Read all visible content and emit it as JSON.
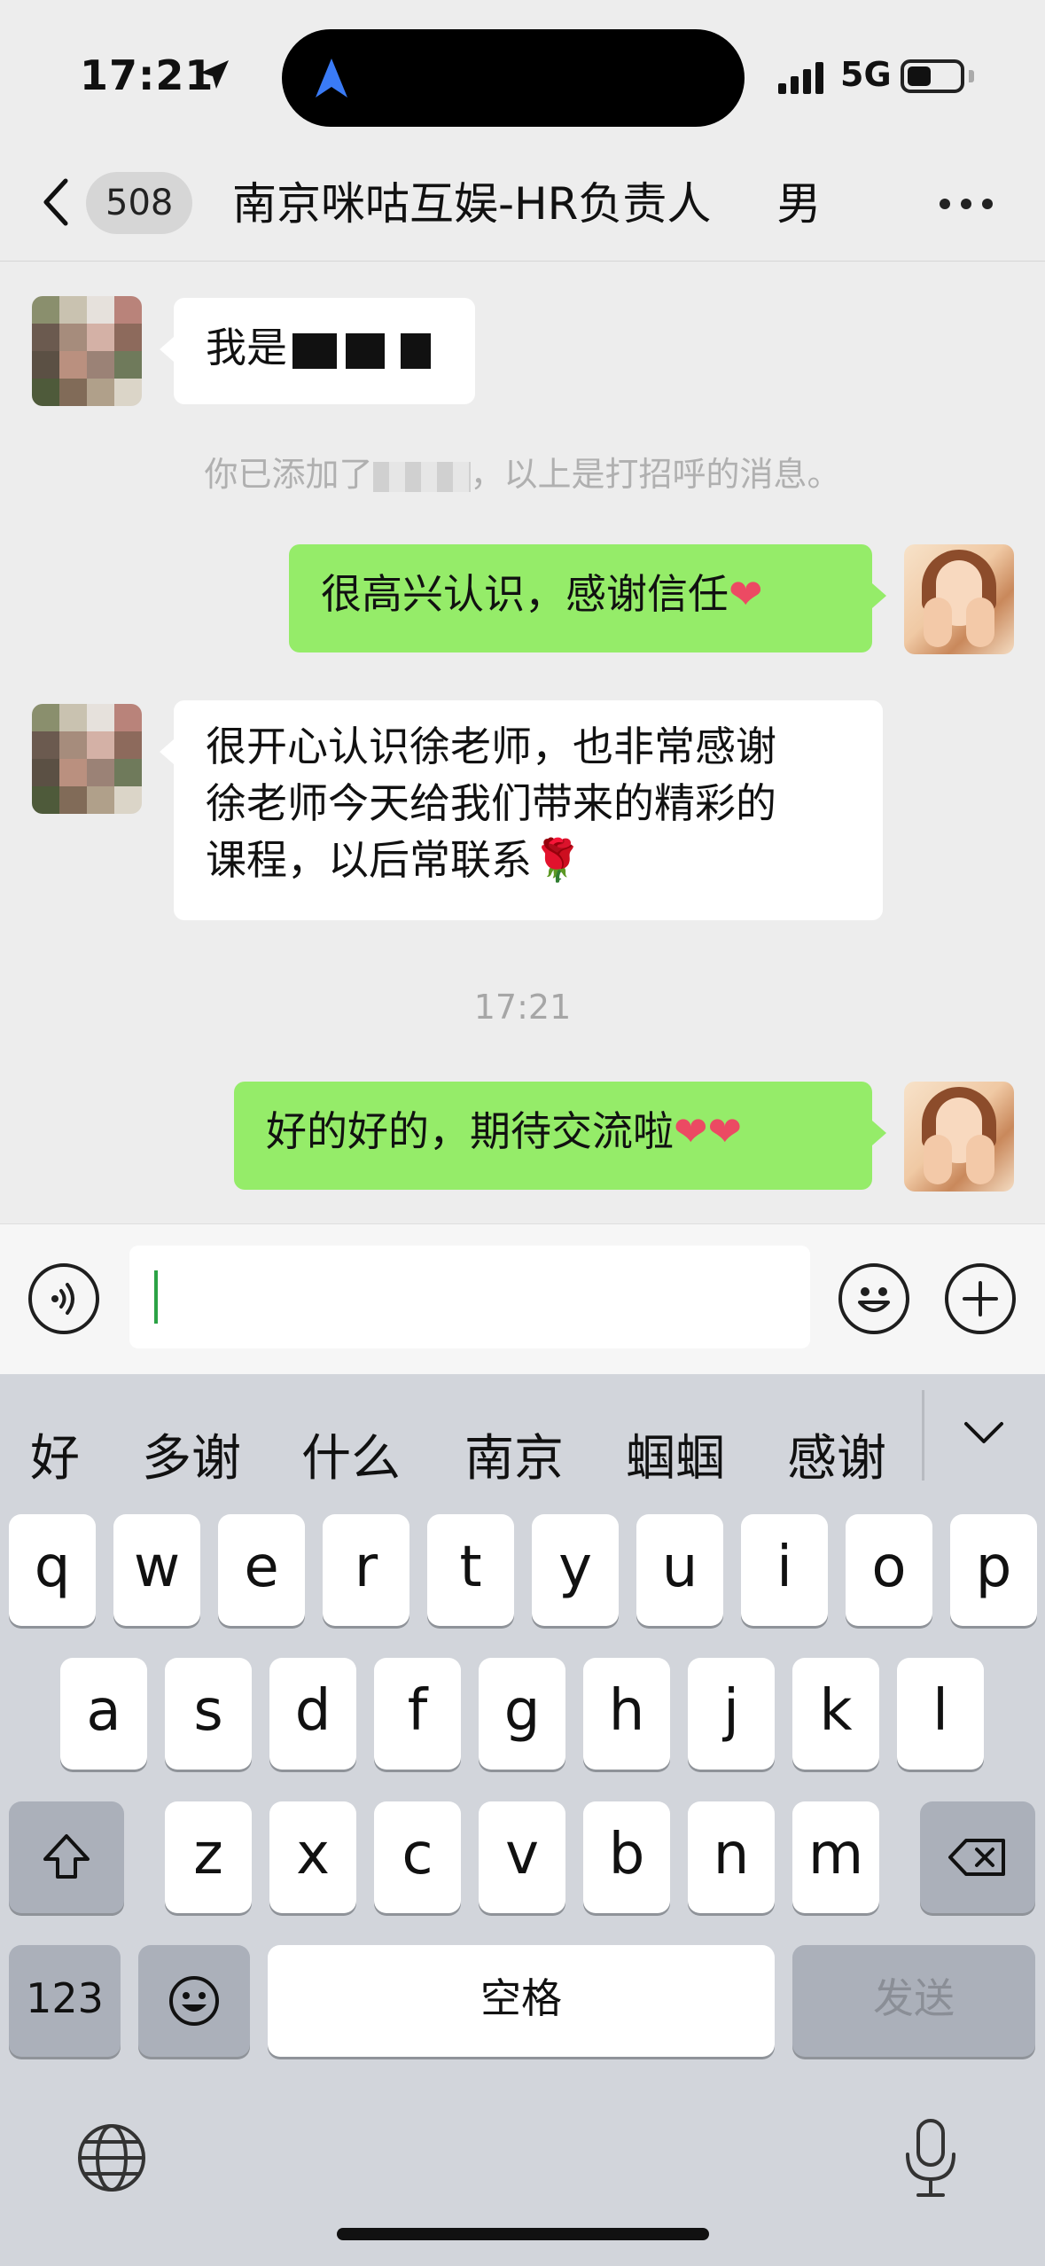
{
  "status_bar": {
    "time": "17:21",
    "network": "5G",
    "icons": [
      "location-arrow-icon",
      "signal-icon",
      "battery-icon"
    ]
  },
  "nav": {
    "unread_count": "508",
    "title": "南京咪咕互娱-HR负责人",
    "title_suffix": "男",
    "icons": [
      "back-chevron-icon",
      "more-dots-icon"
    ]
  },
  "messages": [
    {
      "side": "left",
      "type": "text",
      "text": "我是"
    },
    {
      "type": "system",
      "text_before": "你已添加了",
      "text_after": "，以上是打招呼的消息。"
    },
    {
      "side": "right",
      "type": "text",
      "text": "很高兴认识，感谢信任",
      "emoji": "❤"
    },
    {
      "side": "left",
      "type": "text",
      "lines": [
        "很开心认识徐老师，也非常感谢",
        "徐老师今天给我们带来的精彩的",
        "课程，以后常联系"
      ],
      "emoji": "🌹"
    },
    {
      "type": "timestamp",
      "text": "17:21"
    },
    {
      "side": "right",
      "type": "text",
      "text": "好的好的，期待交流啦",
      "emoji": "❤❤"
    }
  ],
  "input": {
    "value": "",
    "icons": [
      "voice-icon",
      "emoji-icon",
      "plus-icon"
    ]
  },
  "keyboard": {
    "candidates": [
      "好",
      "多谢",
      "什么",
      "南京",
      "蝈蝈",
      "感谢"
    ],
    "row1": [
      "q",
      "w",
      "e",
      "r",
      "t",
      "y",
      "u",
      "i",
      "o",
      "p"
    ],
    "row2": [
      "a",
      "s",
      "d",
      "f",
      "g",
      "h",
      "j",
      "k",
      "l"
    ],
    "row3": [
      "z",
      "x",
      "c",
      "v",
      "b",
      "n",
      "m"
    ],
    "numbers_key": "123",
    "space_key": "空格",
    "send_key": "发送",
    "icons": [
      "shift-icon",
      "delete-icon",
      "emoji-key-icon",
      "globe-icon",
      "mic-icon",
      "collapse-chevron-icon"
    ]
  },
  "colors": {
    "background": "#ededed",
    "outgoing_bubble": "#95ec69",
    "incoming_bubble": "#ffffff",
    "keyboard": "#d2d5db"
  }
}
